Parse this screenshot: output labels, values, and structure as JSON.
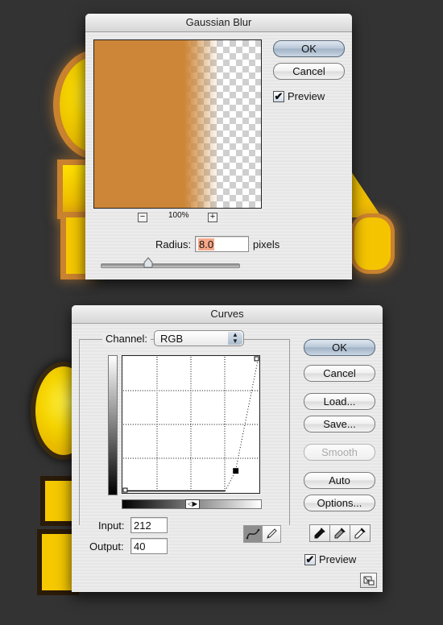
{
  "gaussian_blur": {
    "title": "Gaussian Blur",
    "buttons": {
      "ok": "OK",
      "cancel": "Cancel"
    },
    "preview_checkbox": {
      "label": "Preview",
      "checked": true,
      "mark": "✔"
    },
    "zoom": {
      "minus": "−",
      "plus": "+",
      "level": "100%"
    },
    "radius": {
      "label": "Radius:",
      "value": "8.0",
      "unit": "pixels"
    },
    "colors": {
      "preview_fill": "#cd8637",
      "radius_highlight": "#f6a98a"
    }
  },
  "curves": {
    "title": "Curves",
    "channel": {
      "label": "Channel:",
      "value": "RGB",
      "arrows": "▲\n▼"
    },
    "buttons": {
      "ok": "OK",
      "cancel": "Cancel",
      "load": "Load...",
      "save": "Save...",
      "smooth": "Smooth",
      "auto": "Auto",
      "options": "Options..."
    },
    "input": {
      "label": "Input:",
      "value": "212"
    },
    "output": {
      "label": "Output:",
      "value": "40"
    },
    "preview_checkbox": {
      "label": "Preview",
      "checked": true,
      "mark": "✔"
    },
    "gradient_toggle": "◁▶",
    "curve": {
      "input_range": [
        0,
        255
      ],
      "output_range": [
        0,
        255
      ],
      "grid_divisions": 4,
      "points": [
        [
          0,
          0
        ],
        [
          192,
          0
        ],
        [
          212,
          40
        ],
        [
          255,
          255
        ]
      ],
      "selected_point": [
        212,
        40
      ]
    },
    "tools": [
      "curve-tool",
      "pencil-tool"
    ],
    "eyedroppers": [
      "black-point-eyedropper",
      "gray-point-eyedropper",
      "white-point-eyedropper"
    ]
  }
}
